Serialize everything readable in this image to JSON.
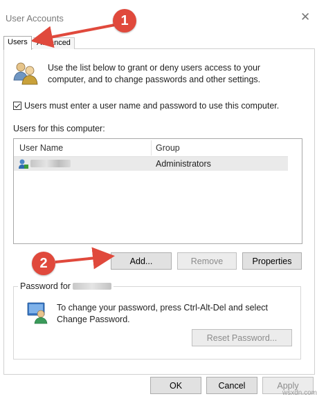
{
  "window": {
    "title": "User Accounts",
    "close_glyph": "✕"
  },
  "tabs": [
    {
      "label": "Users",
      "active": true
    },
    {
      "label": "Advanced",
      "active": false
    }
  ],
  "intro_text": "Use the list below to grant or deny users access to your computer, and to change passwords and other settings.",
  "require_login": {
    "label": "Users must enter a user name and password to use this computer.",
    "checked": true
  },
  "users_section_label": "Users for this computer:",
  "users_table": {
    "columns": [
      "User Name",
      "Group"
    ],
    "rows": [
      {
        "user_name": "",
        "group": "Administrators"
      }
    ]
  },
  "user_buttons": {
    "add": "Add...",
    "remove": "Remove",
    "properties": "Properties"
  },
  "password_group": {
    "legend": "Password for",
    "text": "To change your password, press Ctrl-Alt-Del and select Change Password.",
    "reset_button": "Reset Password..."
  },
  "dialog_buttons": {
    "ok": "OK",
    "cancel": "Cancel",
    "apply": "Apply"
  },
  "annotations": [
    {
      "number": "1"
    },
    {
      "number": "2"
    }
  ],
  "annotation_color": "#e0493c",
  "watermark": "wsxdn.com",
  "icons": [
    "users-group-icon",
    "user-admin-icon",
    "user-key-icon"
  ]
}
